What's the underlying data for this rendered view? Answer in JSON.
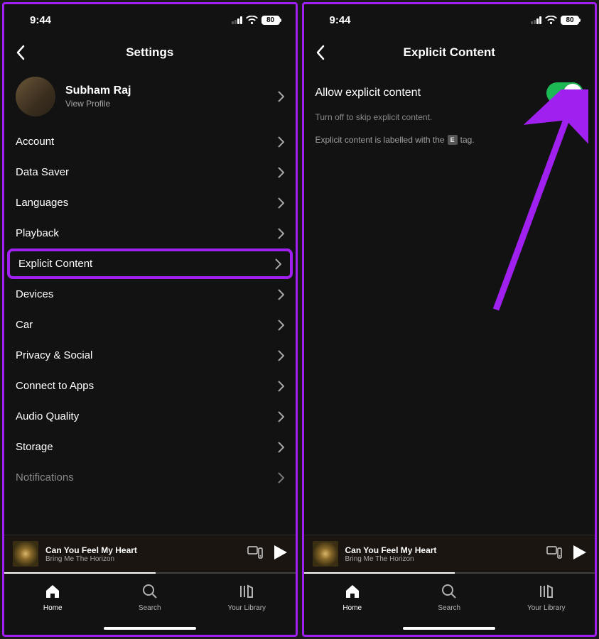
{
  "status": {
    "time": "9:44",
    "battery": "80"
  },
  "left": {
    "title": "Settings",
    "profile": {
      "name": "Subham Raj",
      "subtitle": "View Profile"
    },
    "items": [
      {
        "label": "Account"
      },
      {
        "label": "Data Saver"
      },
      {
        "label": "Languages"
      },
      {
        "label": "Playback"
      },
      {
        "label": "Explicit Content"
      },
      {
        "label": "Devices"
      },
      {
        "label": "Car"
      },
      {
        "label": "Privacy & Social"
      },
      {
        "label": "Connect to Apps"
      },
      {
        "label": "Audio Quality"
      },
      {
        "label": "Storage"
      },
      {
        "label": "Notifications"
      }
    ]
  },
  "right": {
    "title": "Explicit Content",
    "toggle_label": "Allow explicit content",
    "hint1": "Turn off to skip explicit content.",
    "hint2_pre": "Explicit content is labelled with the",
    "hint2_tag": "E",
    "hint2_post": "tag."
  },
  "now_playing": {
    "title": "Can You Feel My Heart",
    "artist": "Bring Me The Horizon"
  },
  "nav": {
    "home": "Home",
    "search": "Search",
    "library": "Your Library"
  }
}
